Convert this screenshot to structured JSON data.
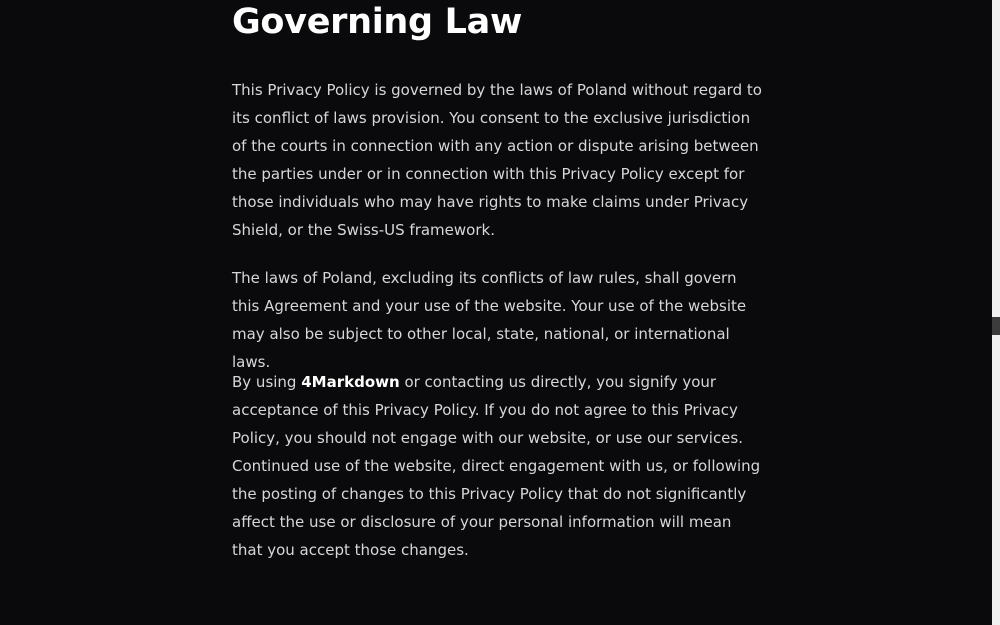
{
  "section": {
    "title": "Governing Law"
  },
  "paragraphs": [
    {
      "text": "This Privacy Policy is governed by the laws of Poland without regard to its conflict of laws provision. You consent to the exclusive jurisdiction of the courts in connection with any action or dispute arising between the parties under or in connection with this Privacy Policy except for those individuals who may have rights to make claims under Privacy Shield, or the Swiss-US framework."
    },
    {
      "text": "The laws of Poland, excluding its conflicts of law rules, shall govern this Agreement and your use of the website. Your use of the website may also be subject to other local, state, national, or international laws."
    },
    {
      "before": "By using ",
      "strong": "4Markdown",
      "after": " or contacting us directly, you signify your acceptance of this Privacy Policy. If you do not agree to this Privacy Policy, you should not engage with our website, or use our services. Continued use of the website, direct engagement with us, or following the posting of changes to this Privacy Policy that do not significantly affect the use or disclosure of your personal information will mean that you accept those changes."
    }
  ],
  "colors": {
    "background": "#0a0a0c",
    "heading": "#ffffff",
    "body_text": "#d7d7d7",
    "scrollbar_track": "#f0f0f0",
    "scrollbar_thumb": "#3c3c3c"
  }
}
